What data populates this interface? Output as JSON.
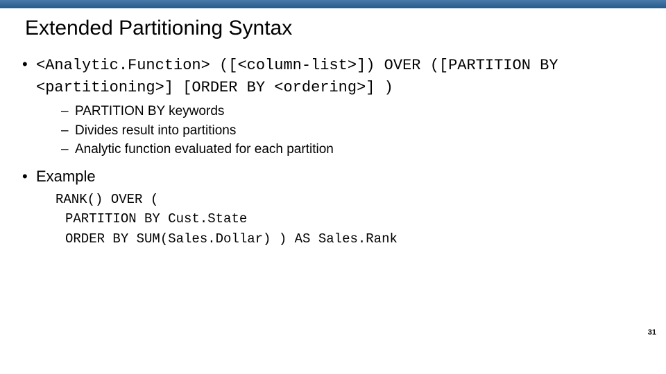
{
  "title": "Extended Partitioning Syntax",
  "syntax": {
    "line1": "<Analytic.Function> ([<column-list>]) OVER ([PARTITION BY",
    "line2": "<partitioning>] [ORDER BY <ordering>] )"
  },
  "sub_points": [
    "PARTITION BY keywords",
    "Divides result into partitions",
    "Analytic function evaluated for each partition"
  ],
  "example_heading": "Example",
  "example_lines": [
    "RANK() OVER (",
    "PARTITION BY Cust.State",
    "ORDER BY SUM(Sales.Dollar) ) AS Sales.Rank"
  ],
  "page_number": "31"
}
